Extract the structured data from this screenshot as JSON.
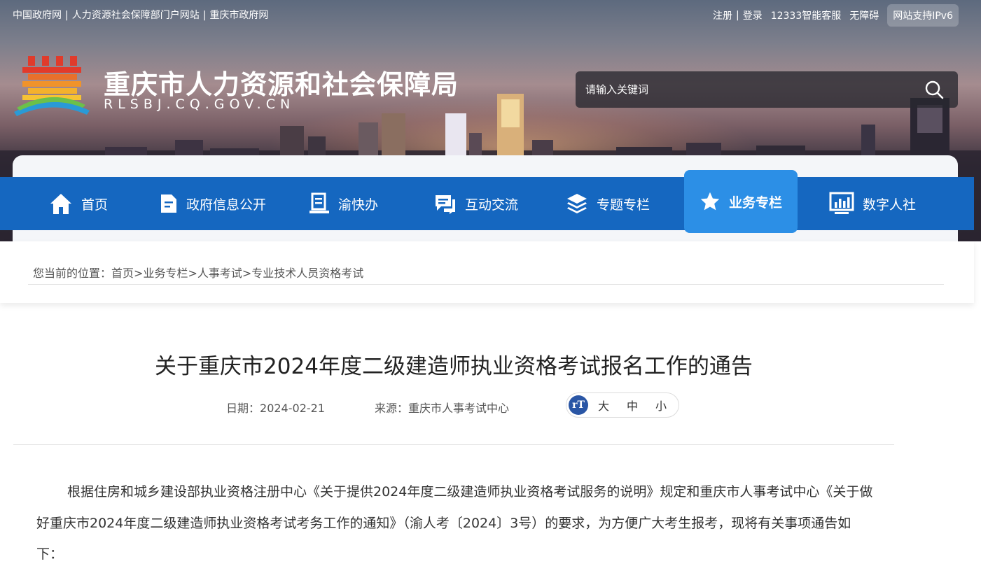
{
  "top_bar": {
    "left_links": [
      "中国政府网",
      "人力资源社会保障部门户网站",
      "重庆市政府网"
    ],
    "separator": "|",
    "register": "注册",
    "login": "登录",
    "hotline": "12333智能客服",
    "accessibility": "无障碍",
    "ipv6": "网站支持IPv6"
  },
  "header": {
    "site_title": "重庆市人力资源和社会保障局",
    "site_domain": "RLSBJ.CQ.GOV.CN",
    "search_placeholder": "请输入关键词"
  },
  "nav": {
    "items": [
      {
        "label": "首页",
        "icon": "home-icon"
      },
      {
        "label": "政府信息公开",
        "icon": "document-icon"
      },
      {
        "label": "渝快办",
        "icon": "desk-icon"
      },
      {
        "label": "互动交流",
        "icon": "chat-icon"
      },
      {
        "label": "专题专栏",
        "icon": "layers-icon"
      },
      {
        "label": "业务专栏",
        "icon": "star-icon",
        "active": true
      },
      {
        "label": "数字人社",
        "icon": "monitor-chart-icon"
      }
    ]
  },
  "breadcrumb": {
    "prefix": "您当前的位置：",
    "items": [
      "首页",
      "业务专栏",
      "人事考试",
      "专业技术人员资格考试"
    ],
    "separator": ">"
  },
  "article": {
    "title": "关于重庆市2024年度二级建造师执业资格考试报名工作的通告",
    "date_label": "日期：",
    "date": "2024-02-21",
    "source_label": "来源：",
    "source": "重庆市人事考试中心",
    "font_sizes": [
      "大",
      "中",
      "小"
    ],
    "paragraph": "根据住房和城乡建设部执业资格注册中心《关于提供2024年度二级建造师执业资格考试服务的说明》规定和重庆市人事考试中心《关于做好重庆市2024年度二级建造师执业资格考试考务工作的通知》（渝人考〔2024〕3号）的要求，为方便广大考生报考，现将有关事项通告如下："
  },
  "colors": {
    "nav_bg": "#1567c0",
    "nav_active": "#2c8fe6",
    "font_icon_bg": "#2a56a5"
  }
}
